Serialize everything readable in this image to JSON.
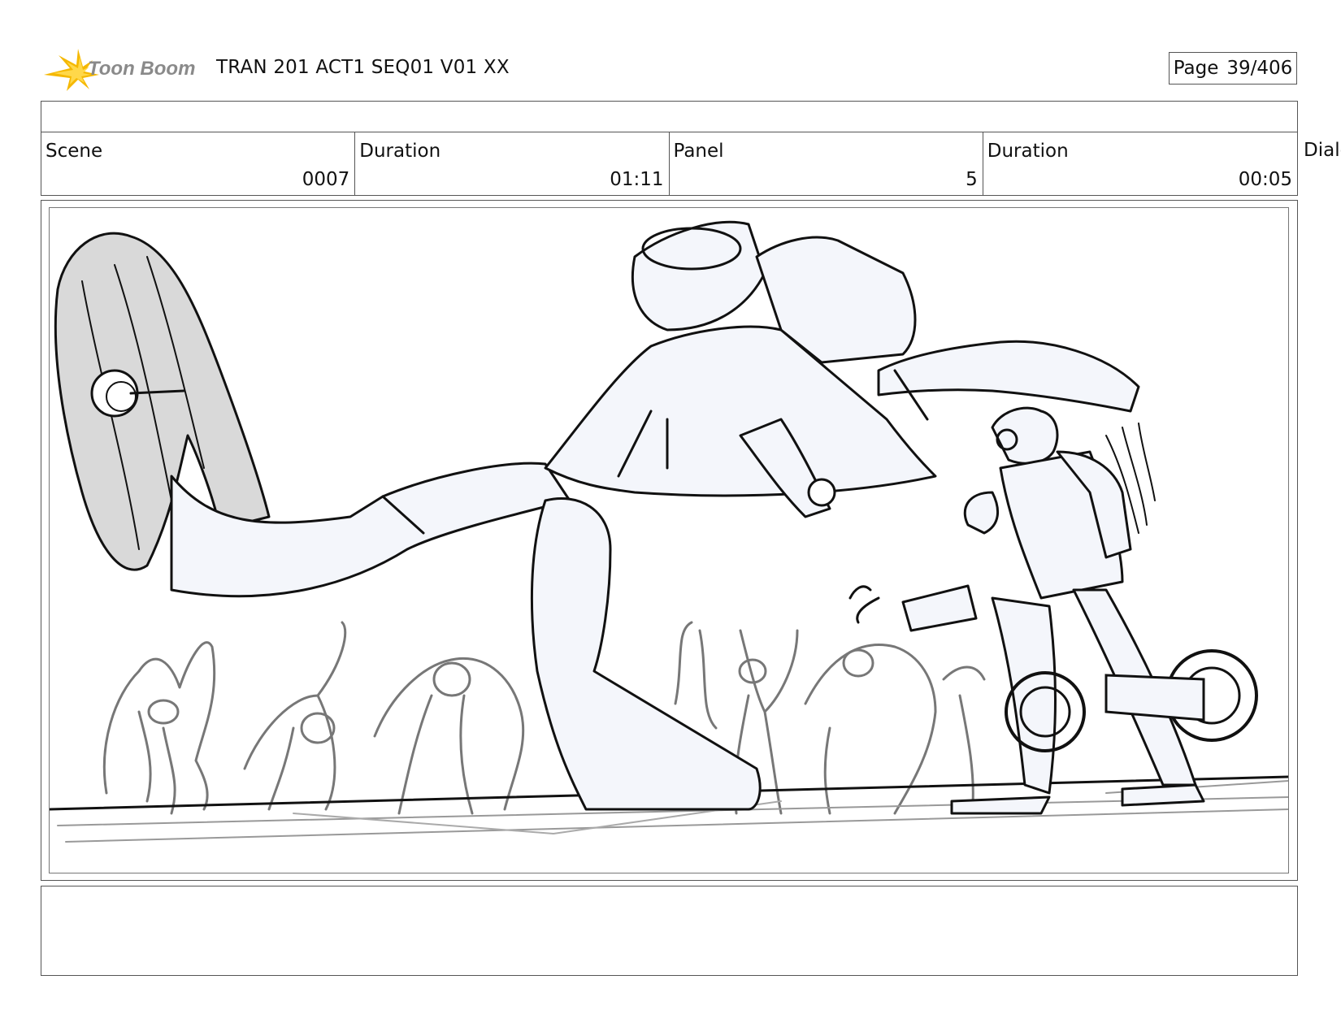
{
  "header": {
    "logo_text": "Toon Boom",
    "title": "TRAN 201 ACT1 SEQ01 V01 XX",
    "page_label": "Page",
    "page_value": "39/406"
  },
  "info": {
    "scene_label": "Scene",
    "scene_value": "0007",
    "scene_duration_label": "Duration",
    "scene_duration_value": "01:11",
    "panel_label": "Panel",
    "panel_value": "5",
    "panel_duration_label": "Duration",
    "panel_duration_value": "00:05",
    "dialog_label": "Dialo"
  },
  "panel": {
    "image_description_icon": "storyboard-sketch"
  },
  "colors": {
    "logo_accent": "#f5b800",
    "logo_text": "#8a8a8a",
    "sketch_fill": "#f4f6fb",
    "hair_fill": "#d9d9d9",
    "crowd_stroke": "#777777"
  }
}
